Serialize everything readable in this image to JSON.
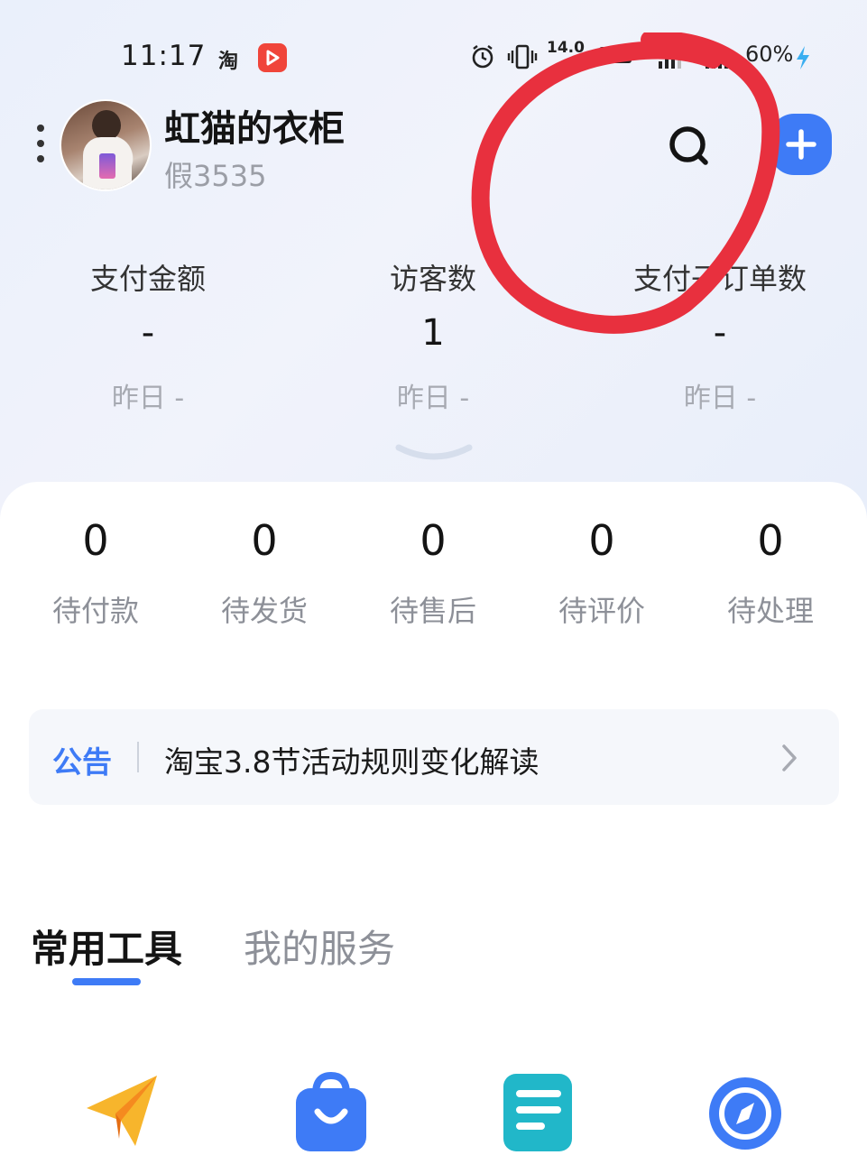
{
  "status_bar": {
    "time": "11:17",
    "taobao_glyph": "淘",
    "speed": "14.0",
    "battery": "60%"
  },
  "header": {
    "shop_name": "虹猫的衣柜",
    "shop_subtitle": "假3535"
  },
  "stats": [
    {
      "label": "支付金额",
      "value": "-",
      "previous": "昨日 -"
    },
    {
      "label": "访客数",
      "value": "1",
      "previous": "昨日 -"
    },
    {
      "label": "支付子订单数",
      "value": "-",
      "previous": "昨日 -"
    }
  ],
  "orders": [
    {
      "count": "0",
      "label": "待付款"
    },
    {
      "count": "0",
      "label": "待发货"
    },
    {
      "count": "0",
      "label": "待售后"
    },
    {
      "count": "0",
      "label": "待评价"
    },
    {
      "count": "0",
      "label": "待处理"
    }
  ],
  "notice": {
    "tag": "公告",
    "text": "淘宝3.8节活动规则变化解读"
  },
  "tabs": {
    "active": "常用工具",
    "inactive": "我的服务"
  },
  "icons": [
    "paper-plane-icon",
    "shopping-bag-icon",
    "document-list-icon",
    "compass-icon"
  ],
  "colors": {
    "accent": "#3e7bf6",
    "annotation": "#e8303e"
  }
}
